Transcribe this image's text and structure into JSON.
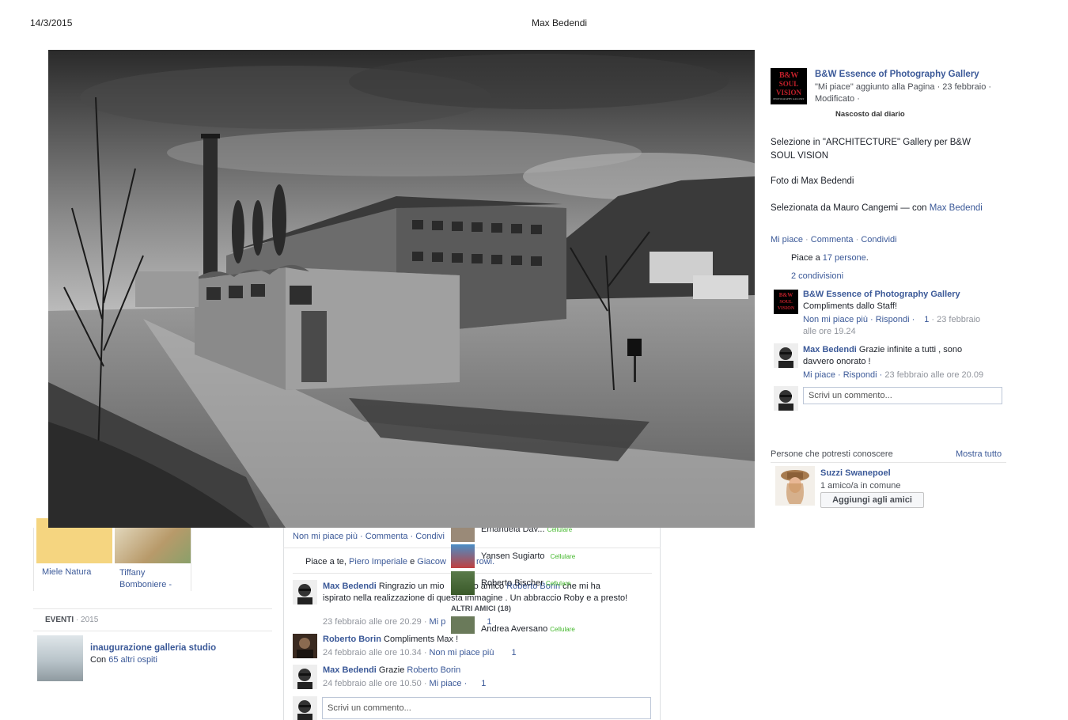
{
  "header": {
    "date": "14/3/2015",
    "title": "Max Bedendi"
  },
  "photo": {
    "alt": ""
  },
  "post": {
    "page_name": "B&W Essence of Photography Gallery",
    "meta_1": "\"Mi piace\" aggiunto alla Pagina · 23 febbraio ·",
    "meta_2": "Modificato ·",
    "hidden": "Nascosto dal diario",
    "desc_1": "Selezione in \"ARCHITECTURE\" Gallery per B&W",
    "desc_2": "SOUL VISION",
    "photo_by": "Foto di Max Bedendi",
    "selected_by": "Selezionata da Mauro Cangemi — con ",
    "selected_with": "Max Bedendi",
    "actions": {
      "like": "Mi piace",
      "comment": "Commenta",
      "share": "Condividi"
    },
    "likes_prefix": "Piace a ",
    "likes_link": "17 persone",
    "likes_suffix": ".",
    "shares": "2 condivisioni",
    "logo": {
      "line1": "B&W",
      "line2": "SOUL VISION",
      "line3": "PHOTOGRAPHY GALLERY"
    }
  },
  "right_comments": [
    {
      "author": "B&W Essence of Photography Gallery",
      "text": "Compliments dallo Staff!",
      "actions": "Non mi piace più · Rispondi ·",
      "likes": "1",
      "time": " · 23 febbraio",
      "time2": "alle ore 19.24"
    },
    {
      "author": "Max Bedendi",
      "text": " Grazie infinite a tutti , sono",
      "text2": "davvero onorato !",
      "actions": "Mi piace · Rispondi ·",
      "time": " 23 febbraio alle ore 20.09"
    }
  ],
  "write_comment": "Scrivi un commento...",
  "people": {
    "title": "Persone che potresti conoscere",
    "see_all": "Mostra tutto",
    "name": "Suzzi Swanepoel",
    "mutual": "1 amico/a in comune",
    "add": "Aggiungi agli amici"
  },
  "background": {
    "pages": [
      {
        "label": "Miele Natura"
      },
      {
        "label": "Tiffany",
        "label2": "Bomboniere -"
      }
    ],
    "events_title": "EVENTI",
    "events_year": " · 2015",
    "event_name": "inaugurazione galleria studio",
    "event_sub_prefix": "Con ",
    "event_sub_link": "65 altri ospiti",
    "bar_actions": "Non mi piace più · Commenta · Condivi",
    "likes_prefix": "Piace a te, ",
    "likes_name1": "Piero Imperiale",
    "likes_mid": " e ",
    "likes_name2": "Giacow",
    "likes_rest": "rowi.",
    "comments": [
      {
        "author": "Max Bedendi",
        "text": " Ringrazio un mio",
        "text_b": "mo amico ",
        "mention": "Roberto Borin",
        "text_c": " che mi ha",
        "text2": "ispirato nella realizzazione di questa immagine . Un abbraccio Roby e a presto!",
        "time": "23 febbraio alle ore 20.29 · ",
        "action": "Mi p",
        "likes": "1"
      },
      {
        "author": "Roberto Borin",
        "text": " Compliments Max !",
        "time": "24 febbraio alle ore 10.34 · ",
        "action": "Non mi piace più",
        "likes": "1"
      },
      {
        "author": "Max Bedendi",
        "text": " Grazie ",
        "mention": "Roberto Borin",
        "time": "24 febbraio alle ore 10.50 · ",
        "action": "Mi piace ·",
        "likes": "1"
      }
    ],
    "write_comment": "Scrivi un commento..."
  },
  "chat": {
    "online": [
      {
        "name": "Emanuela Dav...",
        "status": "Cellulare"
      },
      {
        "name": "Yansen Sugiarto",
        "status": "Cellulare"
      },
      {
        "name": "Roberto Bischer",
        "status": "Cellulare"
      }
    ],
    "other_title": "ALTRI AMICI (18)",
    "other": [
      {
        "name": "Andrea Aversano",
        "status": "Cellulare"
      }
    ]
  }
}
